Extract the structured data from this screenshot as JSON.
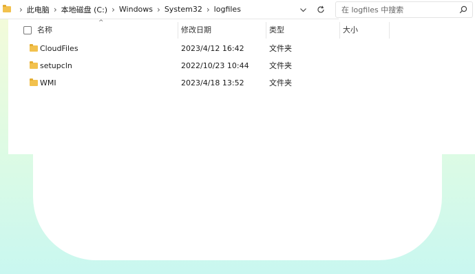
{
  "address": {
    "breadcrumbs": [
      "此电脑",
      "本地磁盘 (C:)",
      "Windows",
      "System32",
      "logfiles"
    ]
  },
  "search": {
    "placeholder": "在 logfiles 中搜索"
  },
  "columns": {
    "name": "名称",
    "modified": "修改日期",
    "type": "类型",
    "size": "大小"
  },
  "files": [
    {
      "name": "CloudFiles",
      "modified": "2023/4/12 16:42",
      "type": "文件夹"
    },
    {
      "name": "setupcln",
      "modified": "2022/10/23 10:44",
      "type": "文件夹"
    },
    {
      "name": "WMI",
      "modified": "2023/4/18 13:52",
      "type": "文件夹"
    }
  ],
  "icons": {
    "breadcrumb_root": "folder-icon",
    "dropdown": "chevron-down-icon",
    "refresh": "refresh-icon",
    "search": "search-icon",
    "sort": "sort-up-icon",
    "row": "folder-icon"
  },
  "colors": {
    "folder": "#f2c14e",
    "background_top": "#f6fbd8",
    "background_bottom": "#c9f7f0"
  }
}
